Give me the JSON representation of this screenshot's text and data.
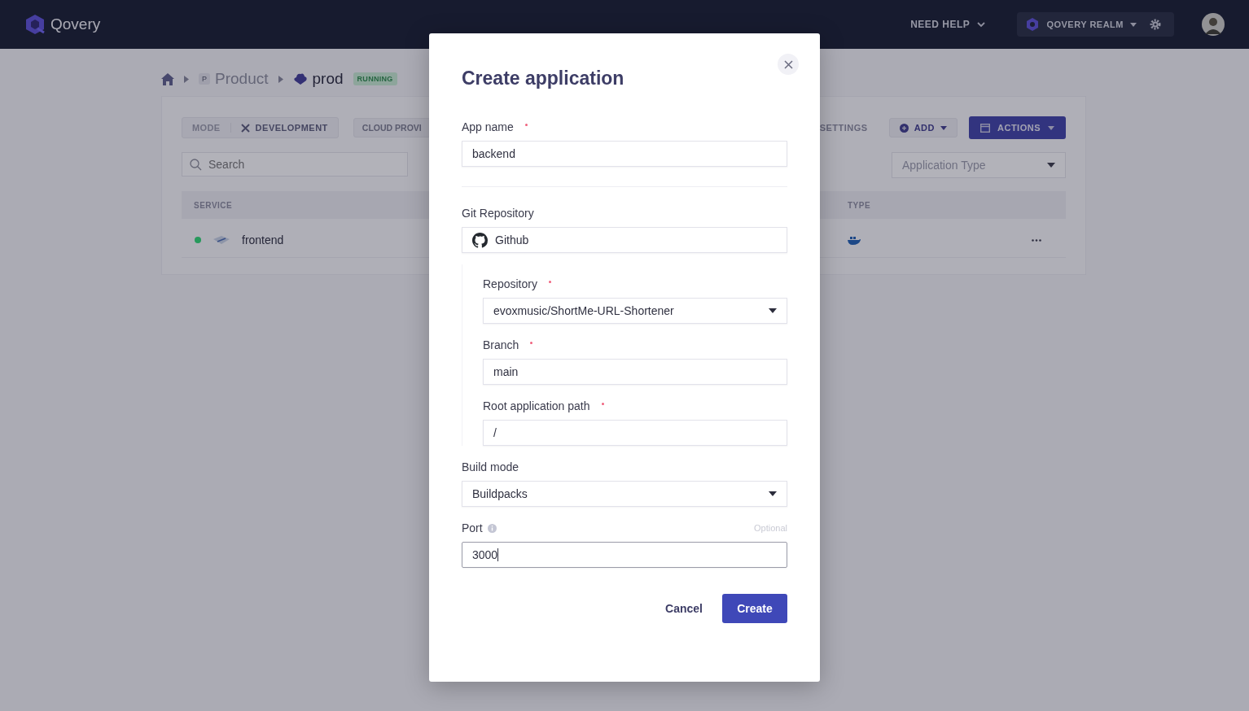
{
  "header": {
    "brand": "Qovery",
    "help": "NEED HELP",
    "organization": "QOVERY REALM"
  },
  "breadcrumb": {
    "project_badge": "P",
    "project": "Product",
    "environment": "prod",
    "status": "RUNNING"
  },
  "toolbar": {
    "mode_label": "MODE",
    "mode": "DEVELOPMENT",
    "cloud": "CLOUD PROVI",
    "settings": "SETTINGS",
    "add": "ADD",
    "actions": "ACTIONS"
  },
  "search": {
    "placeholder": "Search"
  },
  "type_filter": {
    "placeholder": "Application Type"
  },
  "table": {
    "columns": [
      "SERVICE",
      "TYPE"
    ],
    "rows": [
      {
        "name": "frontend",
        "color": "#27995c"
      }
    ]
  },
  "dialog": {
    "title": "Create application",
    "sections": [
      {
        "fields": [
          {
            "kind": "text",
            "label": "App name",
            "required": true,
            "value": "backend"
          }
        ]
      },
      {
        "fields": [
          {
            "kind": "source",
            "label": "Git Repository",
            "required": false,
            "value": "Github",
            "children": [
              {
                "kind": "select",
                "label": "Repository",
                "required": true,
                "value": "evoxmusic/ShortMe-URL-Shortener"
              },
              {
                "kind": "text",
                "label": "Branch",
                "required": true,
                "value": "main"
              },
              {
                "kind": "text",
                "label": "Root application path",
                "required": true,
                "value": "/"
              }
            ]
          },
          {
            "kind": "select",
            "label": "Build mode",
            "required": false,
            "value": "Buildpacks"
          },
          {
            "kind": "text",
            "label": "Port",
            "required": false,
            "info": true,
            "hint": "Optional",
            "value": "3000",
            "focused": true
          }
        ]
      }
    ],
    "buttons": [
      {
        "label": "Cancel",
        "kind": "secondary"
      },
      {
        "label": "Create",
        "kind": "primary"
      }
    ]
  }
}
